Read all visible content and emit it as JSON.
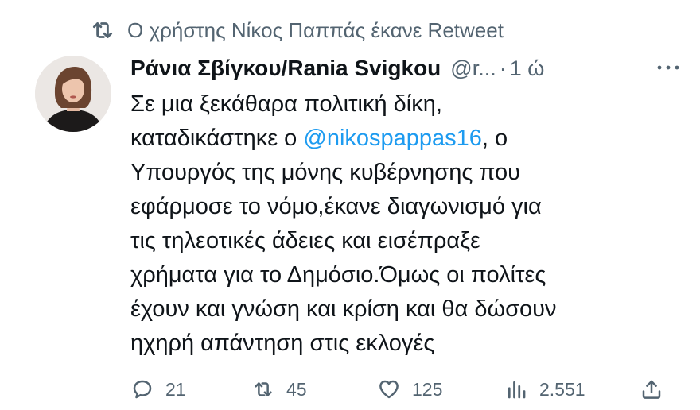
{
  "retweet_banner": {
    "text": "Ο χρήστης Νίκος Παππάς έκανε Retweet",
    "icon": "retweet-icon"
  },
  "tweet": {
    "author": {
      "display_name": "Ράνια Σβίγκου/Rania Svigkou",
      "handle": "@r...",
      "separator": "·",
      "time": "1 ώ",
      "avatar": "avatar-photo"
    },
    "more_icon": "more-dots-icon",
    "text": {
      "line1": "Σε μια ξεκάθαρα πολιτική δίκη,",
      "line2_before": "καταδικάστηκε ο ",
      "mention": "@nikospappas16",
      "line2_after": ",  ο",
      "line3": "Υπουργός της μόνης κυβέρνησης που",
      "line4": "εφάρμοσε το νόμο,έκανε διαγωνισμό για",
      "line5": "τις τηλεοτικές άδειες και εισέπραξε",
      "line6": "χρήματα για το Δημόσιο.Όμως οι πολίτες",
      "line7": "έχουν και γνώση και κρίση και θα δώσουν",
      "line8": "ηχηρή απάντηση στις εκλογές"
    },
    "actions": {
      "replies": {
        "count": "21",
        "icon": "reply-icon"
      },
      "retweets": {
        "count": "45",
        "icon": "retweet-icon"
      },
      "likes": {
        "count": "125",
        "icon": "heart-icon"
      },
      "views": {
        "count": "2.551",
        "icon": "views-icon"
      },
      "share": {
        "icon": "share-icon"
      }
    }
  },
  "colors": {
    "text": "#0f1419",
    "secondary": "#536471",
    "link": "#1d9bf0",
    "background": "#ffffff"
  }
}
